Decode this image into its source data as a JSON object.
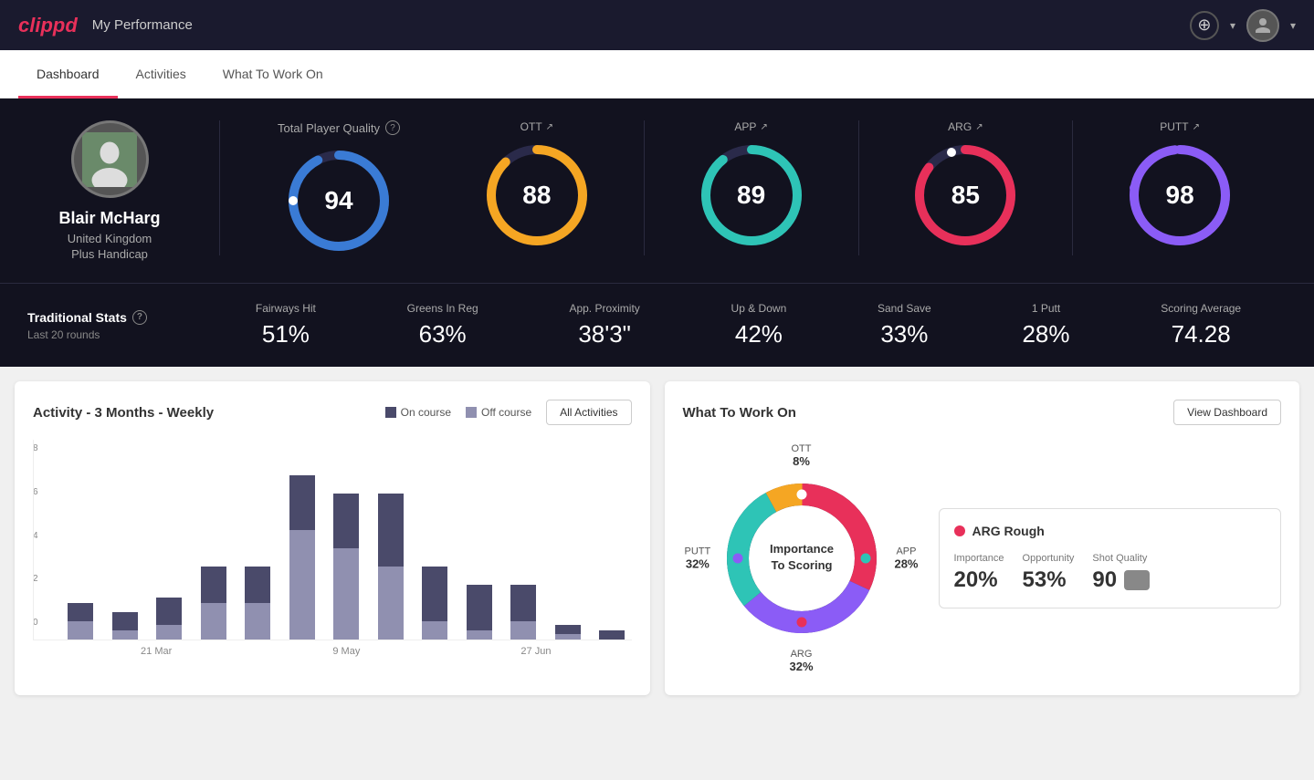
{
  "header": {
    "logo": "clippd",
    "title": "My Performance",
    "add_icon": "+",
    "chevron": "▾"
  },
  "tabs": [
    {
      "id": "dashboard",
      "label": "Dashboard",
      "active": true
    },
    {
      "id": "activities",
      "label": "Activities",
      "active": false
    },
    {
      "id": "what-to-work-on",
      "label": "What To Work On",
      "active": false
    }
  ],
  "player": {
    "name": "Blair McHarg",
    "country": "United Kingdom",
    "handicap": "Plus Handicap"
  },
  "tpq": {
    "label": "Total Player Quality",
    "value": 94,
    "color": "#3a7bd5"
  },
  "scores": [
    {
      "id": "ott",
      "label": "OTT",
      "value": 88,
      "color": "#f5a623",
      "trend": "↗"
    },
    {
      "id": "app",
      "label": "APP",
      "value": 89,
      "color": "#2ec4b6",
      "trend": "↗"
    },
    {
      "id": "arg",
      "label": "ARG",
      "value": 85,
      "color": "#e8305a",
      "trend": "↗"
    },
    {
      "id": "putt",
      "label": "PUTT",
      "value": 98,
      "color": "#8b5cf6",
      "trend": "↗"
    }
  ],
  "traditional_stats": {
    "title": "Traditional Stats",
    "subtitle": "Last 20 rounds",
    "items": [
      {
        "label": "Fairways Hit",
        "value": "51%"
      },
      {
        "label": "Greens In Reg",
        "value": "63%"
      },
      {
        "label": "App. Proximity",
        "value": "38'3\""
      },
      {
        "label": "Up & Down",
        "value": "42%"
      },
      {
        "label": "Sand Save",
        "value": "33%"
      },
      {
        "label": "1 Putt",
        "value": "28%"
      },
      {
        "label": "Scoring Average",
        "value": "74.28"
      }
    ]
  },
  "activity_chart": {
    "title": "Activity - 3 Months - Weekly",
    "legend": [
      {
        "label": "On course",
        "color": "#4a4a6a"
      },
      {
        "label": "Off course",
        "color": "#9090b0"
      }
    ],
    "button": "All Activities",
    "x_labels": [
      "21 Mar",
      "9 May",
      "27 Jun"
    ],
    "y_labels": [
      "0",
      "2",
      "4",
      "6",
      "8"
    ],
    "bars": [
      {
        "on": 1,
        "off": 1
      },
      {
        "on": 1,
        "off": 0.5
      },
      {
        "on": 1.5,
        "off": 0.8
      },
      {
        "on": 2,
        "off": 2
      },
      {
        "on": 2,
        "off": 2
      },
      {
        "on": 3,
        "off": 6
      },
      {
        "on": 3,
        "off": 5
      },
      {
        "on": 4,
        "off": 4
      },
      {
        "on": 3,
        "off": 1
      },
      {
        "on": 2.5,
        "off": 0.5
      },
      {
        "on": 2,
        "off": 1
      },
      {
        "on": 0.5,
        "off": 0.3
      },
      {
        "on": 0.5,
        "off": 0
      }
    ]
  },
  "what_to_work_on": {
    "title": "What To Work On",
    "button": "View Dashboard",
    "donut_center": "Importance\nTo Scoring",
    "segments": [
      {
        "label": "OTT",
        "percent": 8,
        "color": "#f5a623",
        "position": "top"
      },
      {
        "label": "APP",
        "percent": 28,
        "color": "#2ec4b6",
        "position": "right"
      },
      {
        "label": "ARG",
        "percent": 32,
        "color": "#e8305a",
        "position": "bottom"
      },
      {
        "label": "PUTT",
        "percent": 32,
        "color": "#8b5cf6",
        "position": "left"
      }
    ],
    "detail": {
      "title": "ARG Rough",
      "dot_color": "#e8305a",
      "stats": [
        {
          "label": "Importance",
          "value": "20%"
        },
        {
          "label": "Opportunity",
          "value": "53%"
        },
        {
          "label": "Shot Quality",
          "value": "90",
          "badge": true
        }
      ]
    }
  }
}
